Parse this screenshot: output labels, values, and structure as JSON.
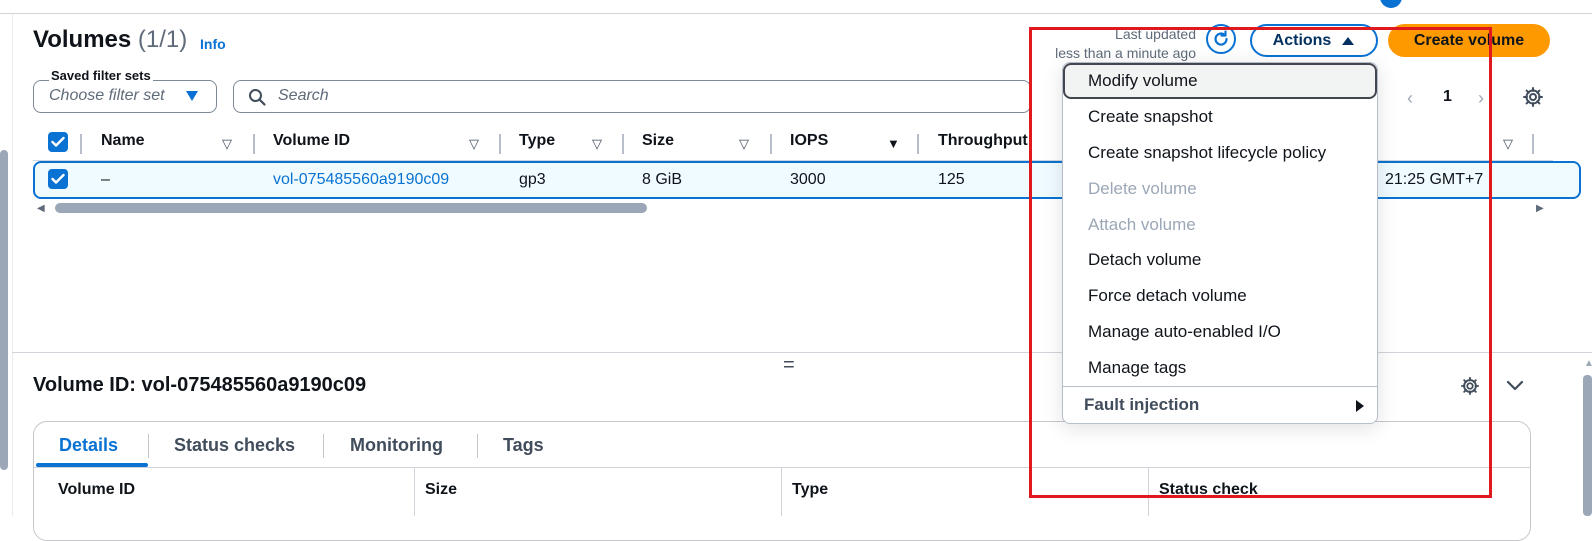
{
  "header": {
    "title": "Volumes",
    "count": "(1/1)",
    "info_link": "Info",
    "last_updated_label": "Last updated",
    "last_updated_value": "less than a minute ago",
    "actions_label": "Actions",
    "create_label": "Create volume"
  },
  "filters": {
    "saved_label": "Saved filter sets",
    "saved_placeholder": "Choose filter set",
    "search_placeholder": "Search"
  },
  "pagination": {
    "prev": "‹",
    "page": "1",
    "next": "›"
  },
  "table": {
    "columns": [
      "Name",
      "Volume ID",
      "Type",
      "Size",
      "IOPS",
      "Throughput"
    ],
    "row": {
      "name": "–",
      "volume_id": "vol-075485560a9190c09",
      "type": "gp3",
      "size": "8 GiB",
      "iops": "3000",
      "throughput": "125",
      "created": "21:25 GMT+7"
    }
  },
  "details": {
    "title": "Volume ID: vol-075485560a9190c09",
    "tabs": [
      "Details",
      "Status checks",
      "Monitoring",
      "Tags"
    ],
    "labels": [
      "Volume ID",
      "Size",
      "Type",
      "Status check"
    ]
  },
  "menu": {
    "items": [
      {
        "label": "Modify volume",
        "disabled": false
      },
      {
        "label": "Create snapshot",
        "disabled": false
      },
      {
        "label": "Create snapshot lifecycle policy",
        "disabled": false
      },
      {
        "label": "Delete volume",
        "disabled": true
      },
      {
        "label": "Attach volume",
        "disabled": true
      },
      {
        "label": "Detach volume",
        "disabled": false
      },
      {
        "label": "Force detach volume",
        "disabled": false
      },
      {
        "label": "Manage auto-enabled I/O",
        "disabled": false
      },
      {
        "label": "Manage tags",
        "disabled": false
      }
    ],
    "fault_injection": "Fault injection"
  },
  "colors": {
    "accent": "#0972d3",
    "primary_button": "#ff9900",
    "highlight": "#e0191f"
  }
}
